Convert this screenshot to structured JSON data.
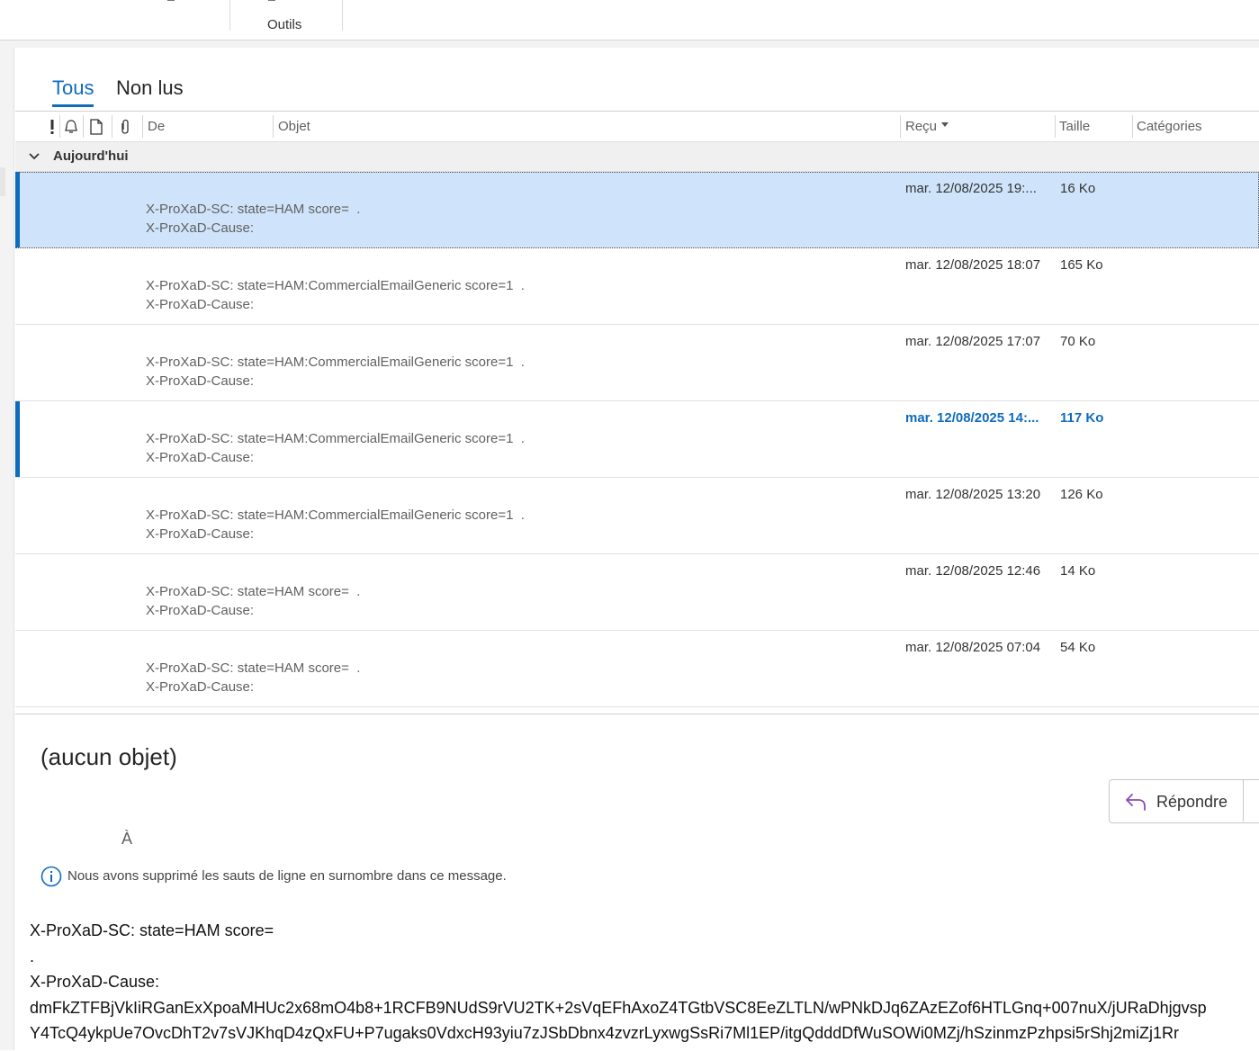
{
  "ribbon": {
    "group_label": "Outils"
  },
  "tabs": [
    {
      "label": "Tous",
      "active": true
    },
    {
      "label": "Non lus",
      "active": false
    }
  ],
  "columns": {
    "importance_icon": "exclamation-icon",
    "reminder_icon": "bell-icon",
    "type_icon": "document-icon",
    "attachment_icon": "paperclip-icon",
    "from": "De",
    "subject": "Objet",
    "received": "Reçu",
    "size": "Taille",
    "categories": "Catégories"
  },
  "group": {
    "label": "Aujourd'hui"
  },
  "messages": [
    {
      "date": "mar. 12/08/2025 19:...",
      "size": "16 Ko",
      "preview1": "X-ProXaD-SC: state=HAM score=  .",
      "preview2": "X-ProXaD-Cause:",
      "state": "selected"
    },
    {
      "date": "mar. 12/08/2025 18:07",
      "size": "165 Ko",
      "preview1": "X-ProXaD-SC: state=HAM:CommercialEmailGeneric score=1  .",
      "preview2": "X-ProXaD-Cause:",
      "state": "read"
    },
    {
      "date": "mar. 12/08/2025 17:07",
      "size": "70 Ko",
      "preview1": "X-ProXaD-SC: state=HAM:CommercialEmailGeneric score=1  .",
      "preview2": "X-ProXaD-Cause:",
      "state": "read"
    },
    {
      "date": "mar. 12/08/2025 14:...",
      "size": "117 Ko",
      "preview1": "X-ProXaD-SC: state=HAM:CommercialEmailGeneric score=1  .",
      "preview2": "X-ProXaD-Cause:",
      "state": "unread"
    },
    {
      "date": "mar. 12/08/2025 13:20",
      "size": "126 Ko",
      "preview1": "X-ProXaD-SC: state=HAM:CommercialEmailGeneric score=1  .",
      "preview2": "X-ProXaD-Cause:",
      "state": "read"
    },
    {
      "date": "mar. 12/08/2025 12:46",
      "size": "14 Ko",
      "preview1": "X-ProXaD-SC: state=HAM score=  .",
      "preview2": "X-ProXaD-Cause:",
      "state": "read"
    },
    {
      "date": "mar. 12/08/2025 07:04",
      "size": "54 Ko",
      "preview1": "X-ProXaD-SC: state=HAM score=  .",
      "preview2": "X-ProXaD-Cause:",
      "state": "read"
    }
  ],
  "reading": {
    "subject": "(aucun objet)",
    "reply_label": "Répondre",
    "to_label": "À",
    "info_text": "Nous avons supprimé les sauts de ligne en surnombre dans ce message.",
    "body": [
      "X-ProXaD-SC: state=HAM score=",
      ".",
      "X-ProXaD-Cause:",
      "dmFkZTFBjVkIiRGanExXpoaMHUc2x68mO4b8+1RCFB9NUdS9rVU2TK+2sVqEFhAxoZ4TGtbVSC8EeZLTLN/wPNkDJq6ZAzEZof6HTLGnq+007nuX/jURaDhjgvsp",
      "Y4TcQ4ykpUe7OvcDhT2v7sVJKhqD4zQxFU+P7ugaks0VdxcH93yiu7zJSbDbnx4zvzrLyxwgSsRi7Ml1EP/itgQdddDfWuSOWi0MZj/hSzinmzPzhpsi5rShj2miZj1Rr"
    ]
  },
  "colors": {
    "accent": "#0f6cbd",
    "selected_row": "#cfe4fa"
  }
}
